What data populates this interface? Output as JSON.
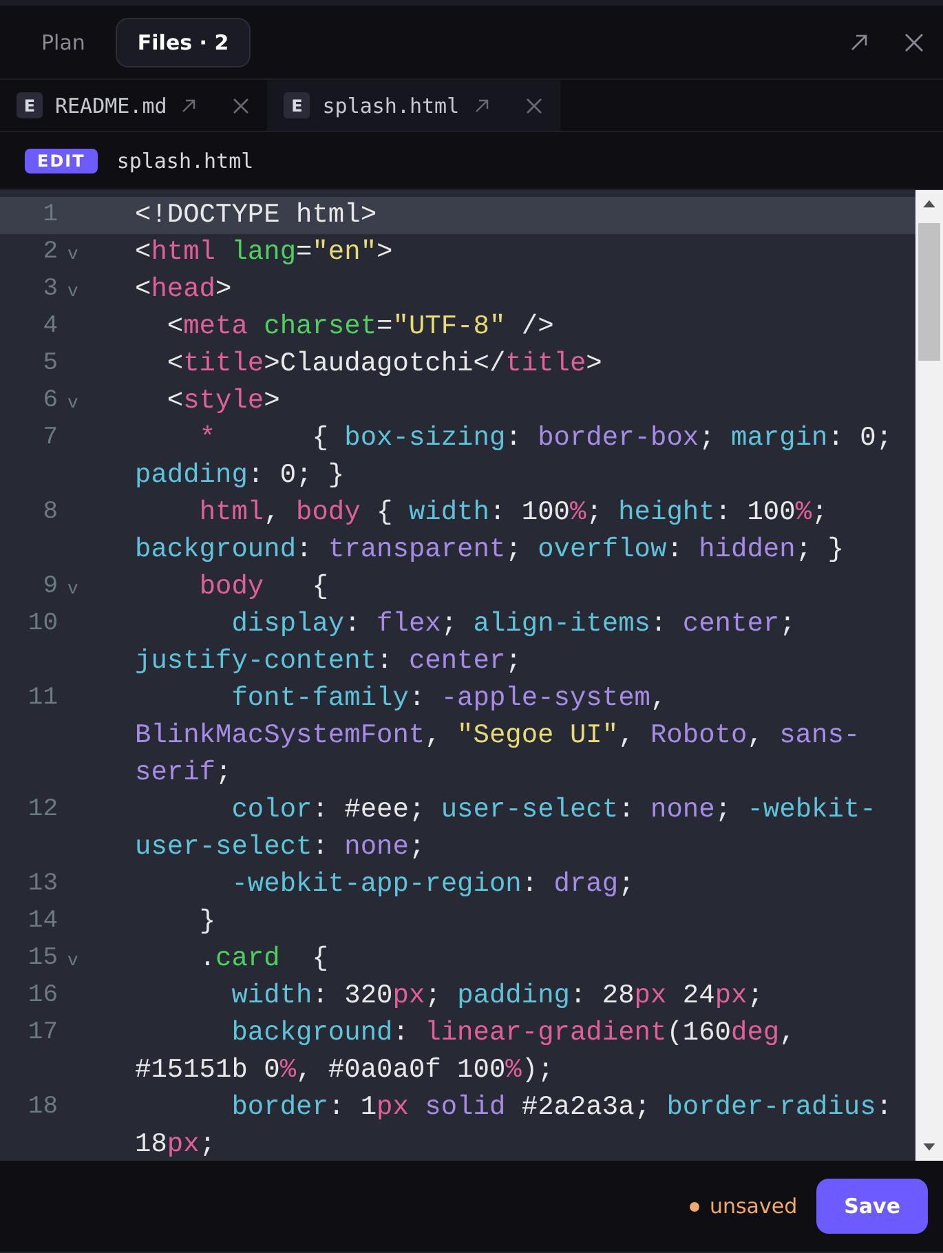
{
  "panel_tabs": [
    {
      "label": "Plan",
      "selected": false
    },
    {
      "label": "Files · 2",
      "selected": true
    }
  ],
  "file_tabs": [
    {
      "badge": "E",
      "name": "README.md",
      "selected": false
    },
    {
      "badge": "E",
      "name": "splash.html",
      "selected": true
    }
  ],
  "editor": {
    "mode_badge": "EDIT",
    "filename": "splash.html",
    "lines": [
      {
        "number": "1",
        "active": true,
        "tokens": [
          {
            "kind": "plain",
            "text": "<!DOCTYPE html>"
          }
        ]
      },
      {
        "number": "2",
        "fold_marker": "v",
        "active": false,
        "tokens": [
          {
            "kind": "plain",
            "text": "<"
          },
          {
            "kind": "tag",
            "text": "html"
          },
          {
            "kind": "attr",
            "text": " lang"
          },
          {
            "kind": "plain",
            "text": "="
          },
          {
            "kind": "string",
            "text": "\"en\""
          },
          {
            "kind": "plain",
            "text": ">"
          }
        ]
      },
      {
        "number": "3",
        "fold_marker": "v",
        "active": false,
        "tokens": [
          {
            "kind": "plain",
            "text": "<"
          },
          {
            "kind": "tag",
            "text": "head"
          },
          {
            "kind": "plain",
            "text": ">"
          }
        ]
      },
      {
        "number": "4",
        "active": false,
        "tokens": [
          {
            "kind": "plain",
            "text": "  <"
          },
          {
            "kind": "tag",
            "text": "meta"
          },
          {
            "kind": "attr",
            "text": " charset"
          },
          {
            "kind": "plain",
            "text": "="
          },
          {
            "kind": "string",
            "text": "\"UTF-8\""
          },
          {
            "kind": "plain",
            "text": " />"
          }
        ]
      },
      {
        "number": "5",
        "active": false,
        "tokens": [
          {
            "kind": "plain",
            "text": "  <"
          },
          {
            "kind": "tag",
            "text": "title"
          },
          {
            "kind": "plain",
            "text": ">Claudagotchi</"
          },
          {
            "kind": "tag",
            "text": "title"
          },
          {
            "kind": "plain",
            "text": ">"
          }
        ]
      },
      {
        "number": "6",
        "fold_marker": "v",
        "active": false,
        "tokens": [
          {
            "kind": "plain",
            "text": "  <"
          },
          {
            "kind": "tag",
            "text": "style"
          },
          {
            "kind": "plain",
            "text": ">"
          }
        ]
      },
      {
        "number": "7",
        "active": false,
        "tokens": [
          {
            "kind": "tag",
            "text": "    *"
          },
          {
            "kind": "plain",
            "text": "      { "
          },
          {
            "kind": "prop",
            "text": "box-sizing"
          },
          {
            "kind": "plain",
            "text": ": "
          },
          {
            "kind": "value",
            "text": "border-box"
          },
          {
            "kind": "plain",
            "text": "; "
          },
          {
            "kind": "prop",
            "text": "margin"
          },
          {
            "kind": "plain",
            "text": ": 0; "
          },
          {
            "kind": "prop",
            "text": "padding"
          },
          {
            "kind": "plain",
            "text": ": 0; }"
          }
        ]
      },
      {
        "number": "8",
        "active": false,
        "tokens": [
          {
            "kind": "tag",
            "text": "    html"
          },
          {
            "kind": "plain",
            "text": ", "
          },
          {
            "kind": "tag",
            "text": "body"
          },
          {
            "kind": "plain",
            "text": " { "
          },
          {
            "kind": "prop",
            "text": "width"
          },
          {
            "kind": "plain",
            "text": ": 100"
          },
          {
            "kind": "unit",
            "text": "%"
          },
          {
            "kind": "plain",
            "text": "; "
          },
          {
            "kind": "prop",
            "text": "height"
          },
          {
            "kind": "plain",
            "text": ": 100"
          },
          {
            "kind": "unit",
            "text": "%"
          },
          {
            "kind": "plain",
            "text": "; "
          },
          {
            "kind": "prop",
            "text": "background"
          },
          {
            "kind": "plain",
            "text": ": "
          },
          {
            "kind": "value",
            "text": "transparent"
          },
          {
            "kind": "plain",
            "text": "; "
          },
          {
            "kind": "prop",
            "text": "overflow"
          },
          {
            "kind": "plain",
            "text": ": "
          },
          {
            "kind": "value",
            "text": "hidden"
          },
          {
            "kind": "plain",
            "text": "; }"
          }
        ]
      },
      {
        "number": "9",
        "fold_marker": "v",
        "active": false,
        "tokens": [
          {
            "kind": "tag",
            "text": "    body"
          },
          {
            "kind": "plain",
            "text": "   {"
          }
        ]
      },
      {
        "number": "10",
        "active": false,
        "tokens": [
          {
            "kind": "prop",
            "text": "      display"
          },
          {
            "kind": "plain",
            "text": ": "
          },
          {
            "kind": "value",
            "text": "flex"
          },
          {
            "kind": "plain",
            "text": "; "
          },
          {
            "kind": "prop",
            "text": "align-items"
          },
          {
            "kind": "plain",
            "text": ": "
          },
          {
            "kind": "value",
            "text": "center"
          },
          {
            "kind": "plain",
            "text": "; "
          },
          {
            "kind": "prop",
            "text": "justify-content"
          },
          {
            "kind": "plain",
            "text": ": "
          },
          {
            "kind": "value",
            "text": "center"
          },
          {
            "kind": "plain",
            "text": ";"
          }
        ]
      },
      {
        "number": "11",
        "active": false,
        "tokens": [
          {
            "kind": "prop",
            "text": "      font-family"
          },
          {
            "kind": "plain",
            "text": ": "
          },
          {
            "kind": "value",
            "text": "-apple-system"
          },
          {
            "kind": "plain",
            "text": ", "
          },
          {
            "kind": "value",
            "text": "BlinkMacSystemFont"
          },
          {
            "kind": "plain",
            "text": ", "
          },
          {
            "kind": "string",
            "text": "\"Segoe UI\""
          },
          {
            "kind": "plain",
            "text": ", "
          },
          {
            "kind": "value",
            "text": "Roboto"
          },
          {
            "kind": "plain",
            "text": ", "
          },
          {
            "kind": "value",
            "text": "sans-serif"
          },
          {
            "kind": "plain",
            "text": ";"
          }
        ]
      },
      {
        "number": "12",
        "active": false,
        "tokens": [
          {
            "kind": "prop",
            "text": "      color"
          },
          {
            "kind": "plain",
            "text": ": #eee; "
          },
          {
            "kind": "prop",
            "text": "user-select"
          },
          {
            "kind": "plain",
            "text": ": "
          },
          {
            "kind": "value",
            "text": "none"
          },
          {
            "kind": "plain",
            "text": "; "
          },
          {
            "kind": "prop",
            "text": "-webkit-user-select"
          },
          {
            "kind": "plain",
            "text": ": "
          },
          {
            "kind": "value",
            "text": "none"
          },
          {
            "kind": "plain",
            "text": ";"
          }
        ]
      },
      {
        "number": "13",
        "active": false,
        "tokens": [
          {
            "kind": "prop",
            "text": "      -webkit-app-region"
          },
          {
            "kind": "plain",
            "text": ": "
          },
          {
            "kind": "value",
            "text": "drag"
          },
          {
            "kind": "plain",
            "text": ";"
          }
        ]
      },
      {
        "number": "14",
        "active": false,
        "tokens": [
          {
            "kind": "plain",
            "text": "    }"
          }
        ]
      },
      {
        "number": "15",
        "fold_marker": "v",
        "active": false,
        "tokens": [
          {
            "kind": "plain",
            "text": "    ."
          },
          {
            "kind": "attr",
            "text": "card"
          },
          {
            "kind": "plain",
            "text": "  {"
          }
        ]
      },
      {
        "number": "16",
        "active": false,
        "tokens": [
          {
            "kind": "prop",
            "text": "      width"
          },
          {
            "kind": "plain",
            "text": ": 320"
          },
          {
            "kind": "unit",
            "text": "px"
          },
          {
            "kind": "plain",
            "text": "; "
          },
          {
            "kind": "prop",
            "text": "padding"
          },
          {
            "kind": "plain",
            "text": ": 28"
          },
          {
            "kind": "unit",
            "text": "px"
          },
          {
            "kind": "plain",
            "text": " 24"
          },
          {
            "kind": "unit",
            "text": "px"
          },
          {
            "kind": "plain",
            "text": ";"
          }
        ]
      },
      {
        "number": "17",
        "active": false,
        "tokens": [
          {
            "kind": "prop",
            "text": "      background"
          },
          {
            "kind": "plain",
            "text": ": "
          },
          {
            "kind": "unit",
            "text": "linear-gradient"
          },
          {
            "kind": "plain",
            "text": "(160"
          },
          {
            "kind": "unit",
            "text": "deg"
          },
          {
            "kind": "plain",
            "text": ", #15151b 0"
          },
          {
            "kind": "unit",
            "text": "%"
          },
          {
            "kind": "plain",
            "text": ", #0a0a0f 100"
          },
          {
            "kind": "unit",
            "text": "%"
          },
          {
            "kind": "plain",
            "text": ");"
          }
        ]
      },
      {
        "number": "18",
        "active": false,
        "tokens": [
          {
            "kind": "prop",
            "text": "      border"
          },
          {
            "kind": "plain",
            "text": ": 1"
          },
          {
            "kind": "unit",
            "text": "px"
          },
          {
            "kind": "value",
            "text": " solid"
          },
          {
            "kind": "plain",
            "text": " #2a2a3a; "
          },
          {
            "kind": "prop",
            "text": "border-radius"
          },
          {
            "kind": "plain",
            "text": ": 18"
          },
          {
            "kind": "unit",
            "text": "px"
          },
          {
            "kind": "plain",
            "text": ";"
          }
        ]
      }
    ]
  },
  "footer": {
    "status": "unsaved",
    "save_button": "Save"
  }
}
